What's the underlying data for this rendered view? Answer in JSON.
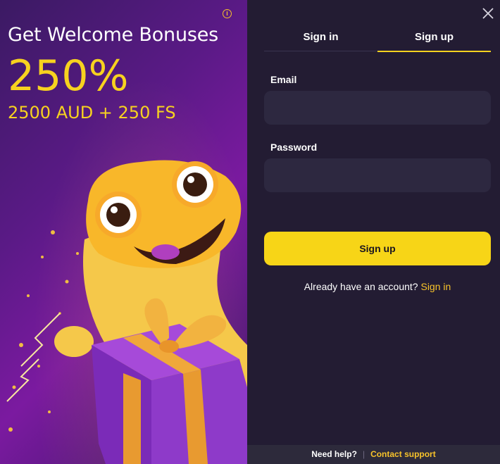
{
  "promo": {
    "title": "Get Welcome Bonuses",
    "percent": "250%",
    "amount": "2500 AUD + 250 FS",
    "info_icon": "info-icon",
    "accent_color": "#f7d21f"
  },
  "tabs": {
    "signin_label": "Sign in",
    "signup_label": "Sign up",
    "active": "Sign up"
  },
  "form": {
    "email_label": "Email",
    "email_value": "",
    "password_label": "Password",
    "password_value": "",
    "submit_label": "Sign up"
  },
  "account": {
    "prompt": "Already have an account?",
    "link": "Sign in"
  },
  "footer": {
    "need_help": "Need help?",
    "contact": "Contact support"
  },
  "icons": {
    "close": "close-icon"
  }
}
